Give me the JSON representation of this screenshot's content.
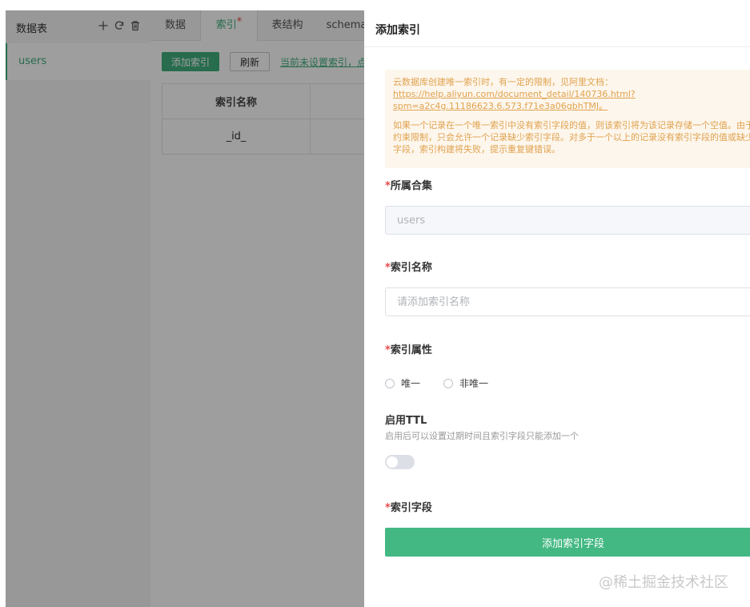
{
  "left_panel": {
    "title": "数据表",
    "icons": [
      "plus-icon",
      "refresh-icon",
      "trash-icon"
    ],
    "items": [
      {
        "label": "users"
      }
    ]
  },
  "tabs": [
    {
      "label": "数据",
      "active": false
    },
    {
      "label": "索引",
      "active": true,
      "modified_marker": "*"
    },
    {
      "label": "表结构",
      "active": false
    },
    {
      "label": "schema",
      "active": false
    }
  ],
  "toolbar": {
    "add_index_label": "添加索引",
    "refresh_label": "刷新",
    "notice_link": "当前未设置索引，点击"
  },
  "index_table": {
    "headers": [
      "索引名称",
      ""
    ],
    "rows": [
      [
        "_id_",
        ""
      ]
    ]
  },
  "drawer": {
    "title": "添加索引",
    "notice": {
      "line1": "云数据库创建唯一索引时，有一定的限制，见阿里文档：",
      "link_line1": "https://help.aliyun.com/document_detail/140736.html?",
      "link_line2": "spm=a2c4g.11186623.6.573.f71e3a06gbhTMJ。",
      "para2_line1": "如果一个记录在一个唯一索引中没有索引字段的值，则该索引将为该记录存储一个空值。由于唯一",
      "para2_line2": "约束限制，只会允许一个记录缺少索引字段。对多于一个以上的记录没有索引字段的值或缺少索引",
      "para2_line3": "字段，索引构建将失败，提示重复键错误。"
    },
    "collection": {
      "label": "所属合集",
      "required_marker": "*",
      "value": "users"
    },
    "index_name": {
      "label": "索引名称",
      "required_marker": "*",
      "placeholder": "请添加索引名称"
    },
    "index_attr": {
      "label": "索引属性",
      "required_marker": "*",
      "options": [
        "唯一",
        "非唯一"
      ]
    },
    "ttl": {
      "label": "启用TTL",
      "hint": "启用后可以设置过期时间且索引字段只能添加一个",
      "enabled": false
    },
    "index_fields": {
      "label": "索引字段",
      "required_marker": "*",
      "add_button": "添加索引字段"
    }
  },
  "watermark": "@稀土掘金技术社区",
  "colors": {
    "accent": "#3fae7d",
    "required": "#e84a4a",
    "notice_text": "#e0a24f",
    "notice_bg": "#fdf6ec"
  }
}
